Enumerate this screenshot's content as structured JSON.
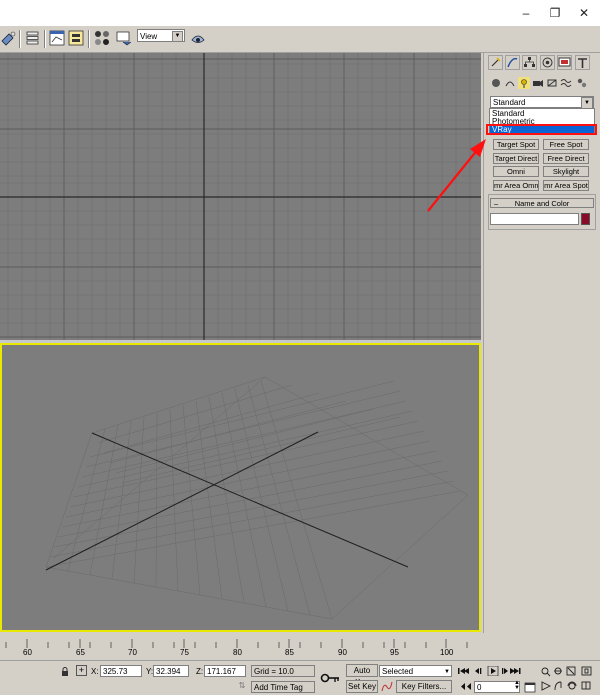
{
  "window": {
    "controls": {
      "minimize": "–",
      "restore": "❐",
      "close": "✕"
    }
  },
  "toolbar": {
    "view_select": "View"
  },
  "command_panel": {
    "type_select": "Standard",
    "dropdown_options": [
      "Standard",
      "Photometric",
      "VRay"
    ],
    "selected_option": "VRay",
    "object_buttons": [
      "Target Spot",
      "Free Spot",
      "Target Direct",
      "Free Direct",
      "Omni",
      "Skylight",
      "mr Area Omni",
      "mr Area Spot"
    ],
    "rollout_title": "Name and Color",
    "rollout_collapse": "–",
    "color": "#8a0a2a"
  },
  "timeline": {
    "ticks": [
      "60",
      "65",
      "70",
      "75",
      "80",
      "85",
      "90",
      "95",
      "100"
    ]
  },
  "status": {
    "x_label": "X:",
    "x_value": "325.73",
    "y_label": "Y:",
    "y_value": "32.394",
    "z_label": "Z:",
    "z_value": "171.167",
    "grid": "Grid = 10.0",
    "add_time_tag": "Add Time Tag",
    "auto_key": "Auto Key",
    "selected": "Selected",
    "set_key": "Set Key",
    "key_filters": "Key Filters...",
    "frame": "0"
  },
  "colors": {
    "viewport_bg": "#7d7d7d",
    "active_viewport_border": "#e8e800",
    "highlight": "#ff1010",
    "selection": "#0a64d6"
  }
}
